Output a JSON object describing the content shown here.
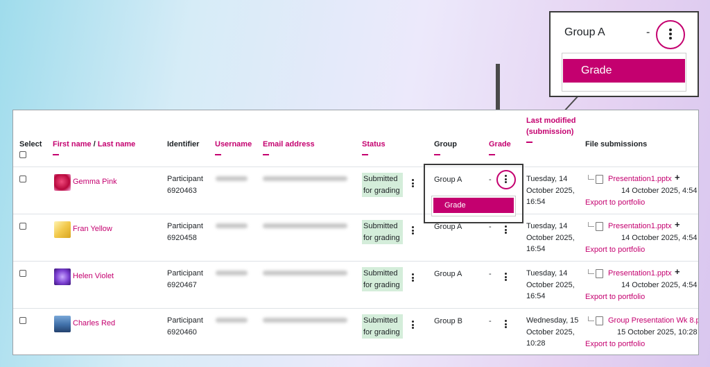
{
  "headers": {
    "select": "Select",
    "first_name": "First name",
    "name_sep": " / ",
    "last_name": "Last name",
    "identifier": "Identifier",
    "username": "Username",
    "email": "Email address",
    "status": "Status",
    "group": "Group",
    "grade": "Grade",
    "last_modified": "Last modified (submission)",
    "file_submissions": "File submissions"
  },
  "rows": [
    {
      "name": "Gemma Pink",
      "identifier": "Participant 6920463",
      "status": "Submitted for grading",
      "group": "Group A",
      "grade": "-",
      "modified": "Tuesday, 14 October 2025, 16:54",
      "file": "Presentation1.pptx",
      "file_date": "14 October 2025, 4:54",
      "export": "Export to portfolio"
    },
    {
      "name": "Fran Yellow",
      "identifier": "Participant 6920458",
      "status": "Submitted for grading",
      "group": "Group A",
      "grade": "-",
      "modified": "Tuesday, 14 October 2025, 16:54",
      "file": "Presentation1.pptx",
      "file_date": "14 October 2025, 4:54",
      "export": "Export to portfolio"
    },
    {
      "name": "Helen Violet",
      "identifier": "Participant 6920467",
      "status": "Submitted for grading",
      "group": "Group A",
      "grade": "-",
      "modified": "Tuesday, 14 October 2025, 16:54",
      "file": "Presentation1.pptx",
      "file_date": "14 October 2025, 4:54",
      "export": "Export to portfolio"
    },
    {
      "name": "Charles Red",
      "identifier": "Participant 6920460",
      "status": "Submitted for grading",
      "group": "Group B",
      "grade": "-",
      "modified": "Wednesday, 15 October 2025, 10:28",
      "file": "Group Presentation Wk 8.p",
      "file_date": "15 October 2025, 10:28 ,",
      "export": "Export to portfolio"
    }
  ],
  "grade_menu": {
    "item": "Grade"
  },
  "zoom": {
    "group": "Group A",
    "grade": "-",
    "menu_item": "Grade"
  },
  "colors": {
    "accent": "#c4006f",
    "status_bg": "#d4edda"
  }
}
